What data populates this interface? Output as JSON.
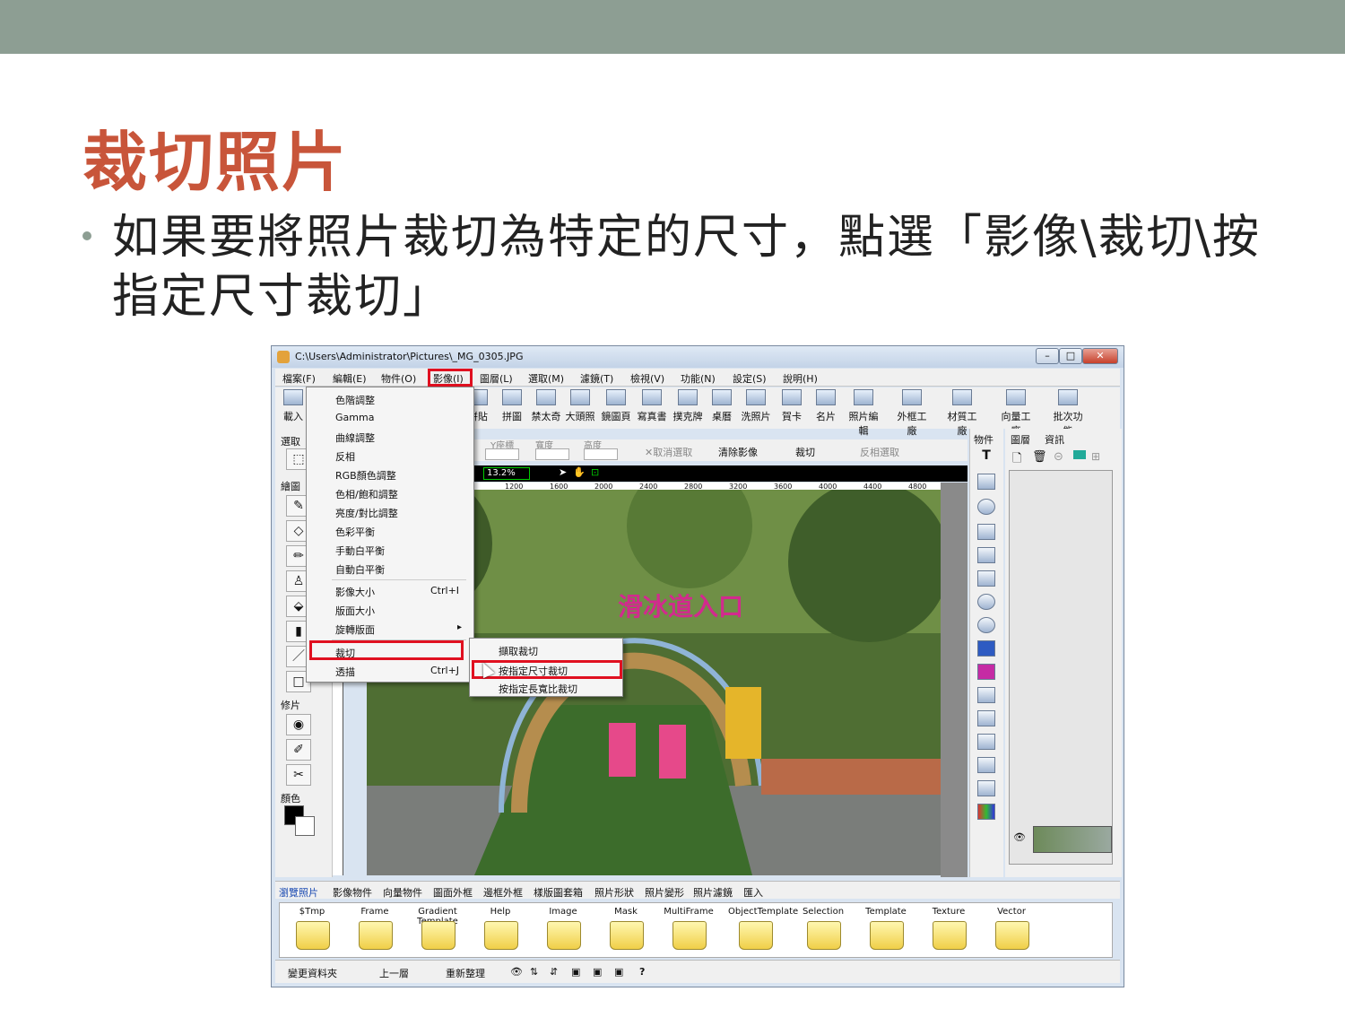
{
  "slide": {
    "title": "裁切照片",
    "bullet": "如果要將照片裁切為特定的尺寸，點選「影像\\裁切\\按指定尺寸裁切」"
  },
  "window": {
    "title": "C:\\Users\\Administrator\\Pictures\\_MG_0305.JPG",
    "min": "–",
    "max": "□",
    "close": "✕"
  },
  "menubar": [
    "檔案(F)",
    "編輯(E)",
    "物件(O)",
    "影像(I)",
    "圖層(L)",
    "選取(M)",
    "濾鏡(T)",
    "檢視(V)",
    "功能(N)",
    "設定(S)",
    "說明(H)"
  ],
  "toolbar": [
    "載入",
    "拼貼",
    "拼圖",
    "禁太奇",
    "大頭照",
    "鏡圖頁",
    "寫真書",
    "撲克牌",
    "桌曆",
    "洗照片",
    "賀卡",
    "名片",
    "照片編輯",
    "外框工廠",
    "材質工廠",
    "向量工廠",
    "批次功能"
  ],
  "left_panel": {
    "select": "選取",
    "draw": "繪圖",
    "retouch": "修片",
    "color": "顏色"
  },
  "options": {
    "y": "Y座標",
    "w": "寬度",
    "h": "高度",
    "cancel": "✕取消選取",
    "clear": "清除影像",
    "crop": "裁切",
    "invert": "反相選取"
  },
  "zoom": "13.2%",
  "ruler": [
    "1200",
    "1600",
    "2000",
    "2400",
    "2800",
    "3200",
    "3600",
    "4000",
    "4400",
    "4800"
  ],
  "photo_sign": "滑冰道入口",
  "right_panel": {
    "objects": "物件",
    "layers": "圖層",
    "info": "資訊"
  },
  "menu": {
    "items": [
      "色階調整",
      "Gamma",
      "曲線調整",
      "反相",
      "RGB顏色調整",
      "色相/飽和調整",
      "亮度/對比調整",
      "色彩平衡",
      "手動白平衡",
      "自動白平衡",
      "影像大小",
      "版面大小",
      "旋轉版面",
      "裁切",
      "透描"
    ],
    "shortcut_size": "Ctrl+I",
    "shortcut_trace": "Ctrl+J",
    "arrow": "▸"
  },
  "submenu": [
    "擷取裁切",
    "按指定尺寸裁切",
    "按指定長寬比裁切"
  ],
  "tabs": [
    "瀏覽照片",
    "影像物件",
    "向量物件",
    "圖面外框",
    "邊框外框",
    "樣版圖套箱",
    "照片形狀",
    "照片變形",
    "照片濾鏡",
    "匯入"
  ],
  "folders": [
    "$Tmp",
    "Frame",
    "Gradient Template",
    "Help",
    "Image",
    "Mask",
    "MultiFrame",
    "ObjectTemplate",
    "Selection",
    "Template",
    "Texture",
    "Vector"
  ],
  "bottombar": {
    "change": "變更資料夾",
    "up": "上一層",
    "refresh": "重新整理",
    "help": "?"
  }
}
